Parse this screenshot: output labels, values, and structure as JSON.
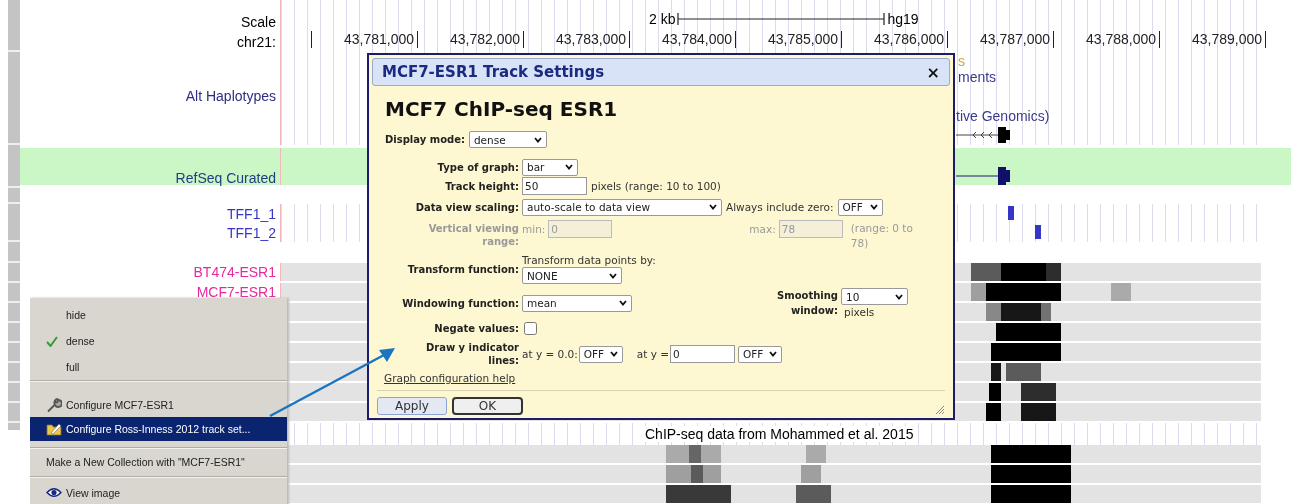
{
  "browser": {
    "ruler": {
      "scale_label": "Scale",
      "chrom_label": "chr21:",
      "scale_size": "2 kb",
      "assembly": "hg19",
      "positions": [
        "43,781,000",
        "43,782,000",
        "43,783,000",
        "43,784,000",
        "43,785,000",
        "43,786,000",
        "43,787,000",
        "43,788,000",
        "43,789,000"
      ]
    },
    "fragments": [
      {
        "text": "s",
        "color": "#d9a040"
      },
      {
        "text": "ments",
        "color": "#3a3a8c"
      },
      {
        "text": "tive Genomics)",
        "color": "#3a3a8c"
      }
    ],
    "tracks": [
      {
        "kind": "alt",
        "label": "Alt Haplotypes",
        "color": "#2e2e80",
        "highlighted": false
      },
      {
        "kind": "refseq",
        "label": "RefSeq Curated",
        "color": "#1f3f7f",
        "highlighted": true
      },
      {
        "kind": "gene",
        "label": "TFF1_1",
        "color": "#3535c8",
        "highlighted": false
      },
      {
        "kind": "gene",
        "label": "TFF1_2",
        "color": "#3535c8",
        "highlighted": false
      },
      {
        "kind": "signal",
        "label": "BT474-ESR1",
        "color": "#e8289c",
        "highlighted": false
      },
      {
        "kind": "signal",
        "label": "MCF7-ESR1",
        "color": "#e8289c",
        "highlighted": false
      }
    ],
    "group_caption": "ChIP-seq data from Mohammed et al. 2015"
  },
  "dialog": {
    "title": "MCF7-ESR1 Track Settings",
    "close": "×",
    "heading": "MCF7 ChIP-seq ESR1",
    "display_mode": {
      "label": "Display mode:",
      "value": "dense"
    },
    "graph_type": {
      "label": "Type of graph:",
      "value": "bar"
    },
    "track_height": {
      "label": "Track height:",
      "value": "50",
      "note": "pixels (range: 10 to 100)"
    },
    "scaling": {
      "label": "Data view scaling:",
      "value": "auto-scale to data view",
      "zero_label": "Always include zero:",
      "zero_value": "OFF"
    },
    "viewing_range": {
      "label": "Vertical viewing range:",
      "disabled": true,
      "min_label": "min:",
      "min_value": "0",
      "max_label": "max:",
      "max_value": "78",
      "note": "(range: 0 to 78)"
    },
    "transform": {
      "label": "Transform function:",
      "hint": "Transform data points by:",
      "value": "NONE"
    },
    "windowing": {
      "label": "Windowing function:",
      "value": "mean"
    },
    "smoothing": {
      "label": "Smoothing window:",
      "value": "10",
      "unit": "pixels"
    },
    "negate": {
      "label": "Negate values:",
      "checked": false
    },
    "indicator": {
      "label": "Draw y indicator lines:",
      "first_label": "at y = 0.0:",
      "first_value": "OFF",
      "second_label": "at y =",
      "second_input": "0",
      "second_value": "OFF"
    },
    "help_link": "Graph configuration help",
    "buttons": [
      {
        "label": "Apply",
        "kind": "apply"
      },
      {
        "label": "OK",
        "kind": "ok"
      }
    ]
  },
  "menu": {
    "sections": [
      [
        {
          "kind": "mode",
          "label": "hide",
          "checked": false,
          "selected": false
        },
        {
          "kind": "mode",
          "label": "dense",
          "checked": true,
          "selected": false
        },
        {
          "kind": "mode",
          "label": "full",
          "checked": false,
          "selected": false
        }
      ],
      [
        {
          "kind": "configure",
          "label": "Configure MCF7-ESR1",
          "selected": false
        },
        {
          "kind": "configure_set",
          "label": "Configure Ross-Inness 2012 track set...",
          "selected": true
        }
      ],
      [
        {
          "kind": "plain",
          "label": "Make a New Collection with \"MCF7-ESR1\"",
          "selected": false
        }
      ],
      [
        {
          "kind": "view",
          "label": "View image",
          "selected": false
        }
      ]
    ]
  }
}
